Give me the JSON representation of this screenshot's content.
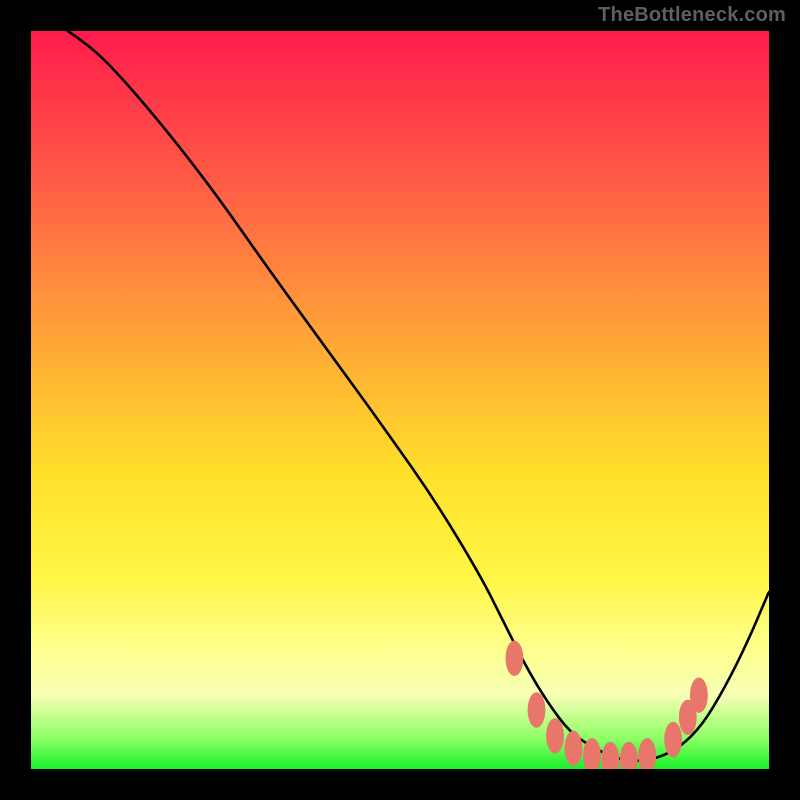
{
  "watermark": "TheBottleneck.com",
  "colors": {
    "frame": "#000000",
    "curve": "#000000",
    "dots": "#e9766a",
    "gradient_stops": [
      "#ff1a4c",
      "#ff8b3d",
      "#ffe02a",
      "#feff88",
      "#17f02a"
    ]
  },
  "chart_data": {
    "type": "line",
    "title": "",
    "xlabel": "",
    "ylabel": "",
    "xlim": [
      0,
      100
    ],
    "ylim": [
      0,
      100
    ],
    "grid": false,
    "legend": false,
    "note": "No numeric axis ticks or labels are rendered in the image; x and y are normalized 0–100. y is the height above the bottom edge (higher = closer to red, lower = closer to green).",
    "series": [
      {
        "name": "curve",
        "x": [
          5,
          8,
          12,
          18,
          25,
          32,
          40,
          48,
          55,
          61,
          64,
          67,
          70,
          73,
          76,
          79,
          82,
          85,
          88,
          91,
          94,
          97,
          100
        ],
        "y": [
          100,
          98,
          94,
          87,
          78,
          68,
          57,
          46,
          36,
          26,
          20,
          14,
          9,
          5,
          3,
          1.5,
          1,
          1.5,
          3,
          6,
          11,
          17,
          24
        ]
      }
    ],
    "markers": {
      "name": "highlight-dots",
      "note": "Salmon dots near the curve minimum; rx/ry ≈ 1.2/2.4 in the same 0–100 units.",
      "points": [
        {
          "x": 65.5,
          "y": 15.0
        },
        {
          "x": 68.5,
          "y": 8.0
        },
        {
          "x": 71.0,
          "y": 4.5
        },
        {
          "x": 73.5,
          "y": 2.8
        },
        {
          "x": 76.0,
          "y": 1.8
        },
        {
          "x": 78.5,
          "y": 1.3
        },
        {
          "x": 81.0,
          "y": 1.3
        },
        {
          "x": 83.5,
          "y": 1.8
        },
        {
          "x": 87.0,
          "y": 4.0
        },
        {
          "x": 89.0,
          "y": 7.0
        },
        {
          "x": 90.5,
          "y": 10.0
        }
      ]
    }
  }
}
